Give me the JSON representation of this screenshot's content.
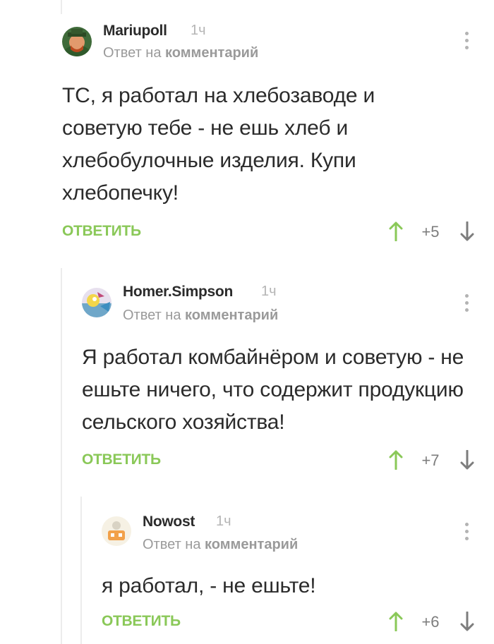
{
  "accent_color": "#8ac858",
  "comments": [
    {
      "username": "Mariupoll",
      "time": "1ч",
      "reply_prefix": "Ответ на",
      "reply_target": "комментарий",
      "text": "ТС, я работал на хлебозаводе и советую тебе - не ешь хлеб и хлебобулочные изделия. Купи хлебопечку!",
      "reply_label": "ОТВЕТИТЬ",
      "rating": "+5",
      "avatar_icon": "user-avatar-icon",
      "menu_icon": "more-vert-icon"
    },
    {
      "username": "Homer.Simpson",
      "time": "1ч",
      "reply_prefix": "Ответ на",
      "reply_target": "комментарий",
      "text": "Я работал комбайнёром и советую - не ешьте ничего, что содержит продукцию сельского хозяйства!",
      "reply_label": "ОТВЕТИТЬ",
      "rating": "+7",
      "avatar_icon": "user-avatar-icon",
      "menu_icon": "more-vert-icon"
    },
    {
      "username": "Nowost",
      "time": "1ч",
      "reply_prefix": "Ответ на",
      "reply_target": "комментарий",
      "text": "я работал, - не ешьте!",
      "reply_label": "ОТВЕТИТЬ",
      "rating": "+6",
      "avatar_icon": "user-avatar-icon",
      "menu_icon": "more-vert-icon"
    }
  ]
}
